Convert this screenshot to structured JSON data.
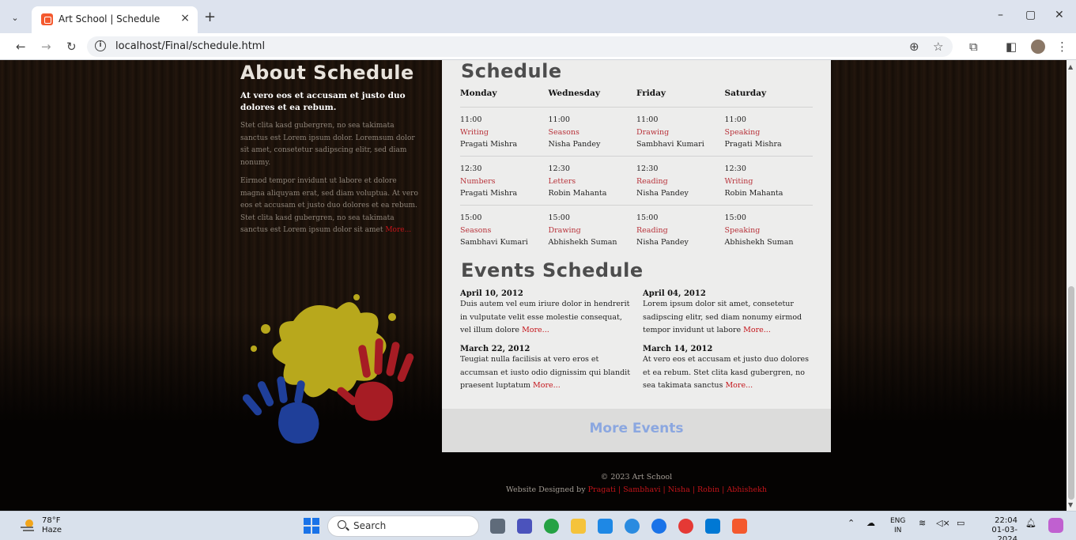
{
  "browser": {
    "tab_title": "Art School | Schedule",
    "tab_close": "×",
    "new_tab": "+",
    "url": "localhost/Final/schedule.html",
    "window_buttons": {
      "minimize": "–",
      "restore": "▢",
      "close": "✕"
    }
  },
  "about": {
    "title": "About Schedule",
    "lead": "At vero eos et accusam et justo duo dolores et ea rebum.",
    "para1": "Stet clita kasd gubergren, no sea takimata sanctus est Lorem ipsum dolor. Loremsum dolor sit amet, consetetur sadipscing elitr, sed diam nonumy.",
    "para2": "Eirmod tempor invidunt ut labore et dolore magna aliquyam erat, sed diam voluptua. At vero eos et accusam et justo duo dolores et ea rebum. Stet clita kasd gubergren, no sea takimata sanctus est Lorem ipsum dolor sit amet ",
    "more": "More..."
  },
  "schedule": {
    "title": "Schedule",
    "days": [
      "Monday",
      "Wednesday",
      "Friday",
      "Saturday"
    ],
    "rows": [
      [
        {
          "time": "11:00",
          "subject": "Writing",
          "teacher": "Pragati Mishra"
        },
        {
          "time": "11:00",
          "subject": "Seasons",
          "teacher": "Nisha Pandey"
        },
        {
          "time": "11:00",
          "subject": "Drawing",
          "teacher": "Sambhavi Kumari"
        },
        {
          "time": "11:00",
          "subject": "Speaking",
          "teacher": "Pragati Mishra"
        }
      ],
      [
        {
          "time": "12:30",
          "subject": "Numbers",
          "teacher": "Pragati Mishra"
        },
        {
          "time": "12:30",
          "subject": "Letters",
          "teacher": "Robin Mahanta"
        },
        {
          "time": "12:30",
          "subject": "Reading",
          "teacher": "Nisha Pandey"
        },
        {
          "time": "12:30",
          "subject": "Writing",
          "teacher": "Robin Mahanta"
        }
      ],
      [
        {
          "time": "15:00",
          "subject": "Seasons",
          "teacher": "Sambhavi Kumari"
        },
        {
          "time": "15:00",
          "subject": "Drawing",
          "teacher": "Abhishekh Suman"
        },
        {
          "time": "15:00",
          "subject": "Reading",
          "teacher": "Nisha Pandey"
        },
        {
          "time": "15:00",
          "subject": "Speaking",
          "teacher": "Abhishekh Suman"
        }
      ]
    ]
  },
  "events": {
    "title": "Events Schedule",
    "items": [
      {
        "date": "April 10, 2012",
        "text": "Duis autem vel eum iriure dolor in hendrerit in vulputate velit esse molestie consequat, vel illum dolore ",
        "more": "More..."
      },
      {
        "date": "April 04, 2012",
        "text": "Lorem ipsum dolor sit amet, consetetur sadipscing elitr, sed diam nonumy eirmod tempor invidunt ut labore ",
        "more": "More..."
      },
      {
        "date": "March 22, 2012",
        "text": "Teugiat nulla facilisis at vero eros et accumsan et iusto odio dignissim qui blandit praesent luptatum ",
        "more": "More..."
      },
      {
        "date": "March 14, 2012",
        "text": "At vero eos et accusam et justo duo dolores et ea rebum. Stet clita kasd gubergren, no sea takimata sanctus ",
        "more": "More..."
      }
    ],
    "more_events": "More Events"
  },
  "footer": {
    "copyright": "© 2023 Art School",
    "designed_by": "Website Designed by ",
    "names": "Pragati | Sambhavi | Nisha | Robin | Abhishekh"
  },
  "taskbar": {
    "weather_temp": "78°F",
    "weather_desc": "Haze",
    "search_label": "Search",
    "lang_top": "ENG",
    "lang_bottom": "IN",
    "time": "22:04",
    "date": "01-03-2024"
  },
  "colors": {
    "accent_red": "#c4141a",
    "subject_red": "#b8323a",
    "more_events_blue": "#8ba7e0"
  }
}
